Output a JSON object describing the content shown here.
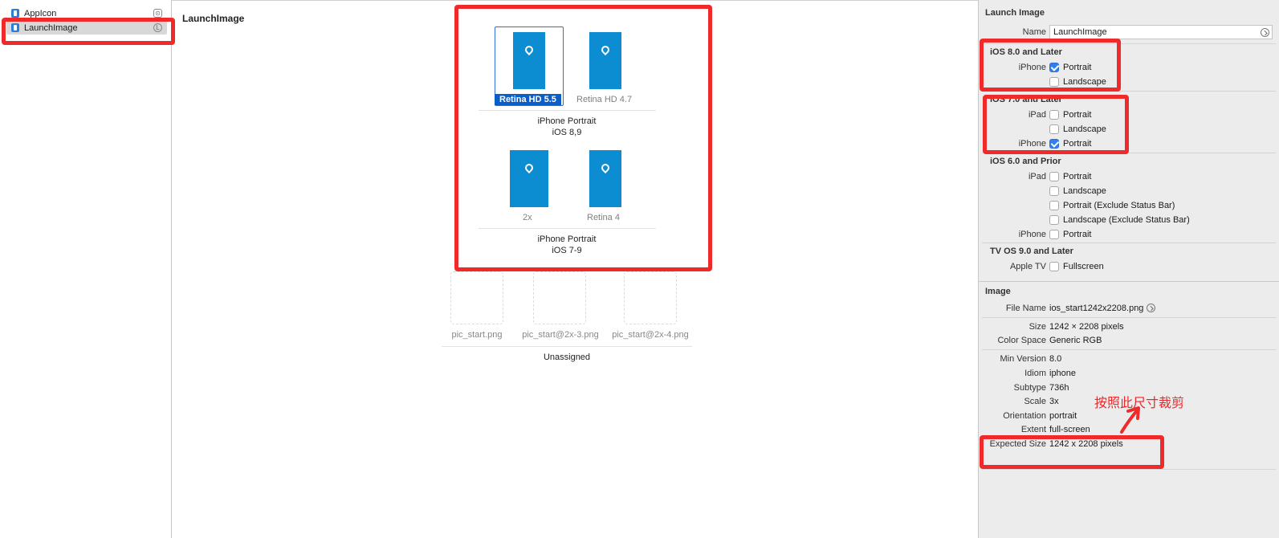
{
  "navigator": {
    "items": [
      {
        "label": "AppIcon",
        "status": "⊙"
      },
      {
        "label": "LaunchImage",
        "status": "L"
      }
    ]
  },
  "editor": {
    "title": "LaunchImage",
    "groups": [
      {
        "slots": [
          {
            "label": "Retina HD 5.5",
            "selected": true
          },
          {
            "label": "Retina HD 4.7",
            "selected": false
          }
        ],
        "caption_line1": "iPhone Portrait",
        "caption_line2": "iOS 8,9"
      },
      {
        "slots": [
          {
            "label": "2x",
            "selected": false
          },
          {
            "label": "Retina 4",
            "selected": false
          }
        ],
        "caption_line1": "iPhone Portrait",
        "caption_line2": "iOS 7-9"
      }
    ],
    "unassigned": {
      "files": [
        "pic_start.png",
        "pic_start@2x-3.png",
        "pic_start@2x-4.png"
      ],
      "caption": "Unassigned"
    }
  },
  "inspector": {
    "launch_image": {
      "section_title": "Launch Image",
      "name_label": "Name",
      "name_value": "LaunchImage",
      "ios8": {
        "title": "iOS 8.0 and Later",
        "rows": [
          {
            "device": "iPhone",
            "option": "Portrait",
            "checked": true
          },
          {
            "device": "",
            "option": "Landscape",
            "checked": false
          }
        ]
      },
      "ios7": {
        "title": "iOS 7.0 and Later",
        "rows": [
          {
            "device": "iPad",
            "option": "Portrait",
            "checked": false
          },
          {
            "device": "",
            "option": "Landscape",
            "checked": false
          },
          {
            "device": "iPhone",
            "option": "Portrait",
            "checked": true
          }
        ]
      },
      "ios6": {
        "title": "iOS 6.0 and Prior",
        "rows": [
          {
            "device": "iPad",
            "option": "Portrait",
            "checked": false
          },
          {
            "device": "",
            "option": "Landscape",
            "checked": false
          },
          {
            "device": "",
            "option": "Portrait (Exclude Status Bar)",
            "checked": false
          },
          {
            "device": "",
            "option": "Landscape (Exclude Status Bar)",
            "checked": false
          },
          {
            "device": "iPhone",
            "option": "Portrait",
            "checked": false
          }
        ]
      },
      "tvos": {
        "title": "TV OS 9.0 and Later",
        "rows": [
          {
            "device": "Apple TV",
            "option": "Fullscreen",
            "checked": false
          }
        ]
      }
    },
    "image": {
      "section_title": "Image",
      "file_name_label": "File Name",
      "file_name": "ios_start1242x2208.png",
      "size_label": "Size",
      "size": "1242 × 2208 pixels",
      "color_space_label": "Color Space",
      "color_space": "Generic RGB",
      "min_version_label": "Min Version",
      "min_version": "8.0",
      "idiom_label": "Idiom",
      "idiom": "iphone",
      "subtype_label": "Subtype",
      "subtype": "736h",
      "scale_label": "Scale",
      "scale": "3x",
      "orientation_label": "Orientation",
      "orientation": "portrait",
      "extent_label": "Extent",
      "extent": "full-screen",
      "expected_size_label": "Expected Size",
      "expected_size": "1242 x 2208 pixels"
    }
  },
  "annotation": {
    "text": "按照此尺寸裁剪",
    "color": "#ee2a2a"
  }
}
